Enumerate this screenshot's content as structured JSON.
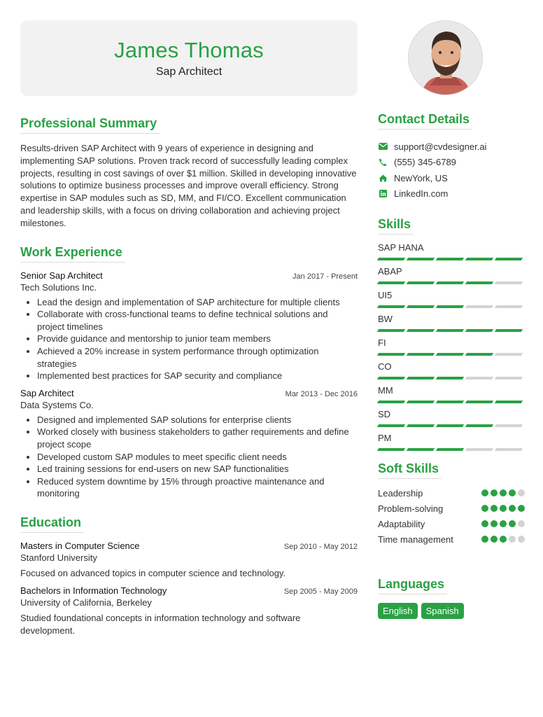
{
  "header": {
    "name": "James Thomas",
    "title": "Sap Architect"
  },
  "photo": {
    "alt": "profile-photo"
  },
  "sections": {
    "summary": "Professional Summary",
    "experience": "Work Experience",
    "education": "Education",
    "contact": "Contact Details",
    "skills": "Skills",
    "soft_skills": "Soft Skills",
    "languages": "Languages"
  },
  "summary": "Results-driven SAP Architect with 9 years of experience in designing and implementing SAP solutions. Proven track record of successfully leading complex projects, resulting in cost savings of over $1 million. Skilled in developing innovative solutions to optimize business processes and improve overall efficiency. Strong expertise in SAP modules such as SD, MM, and FI/CO. Excellent communication and leadership skills, with a focus on driving collaboration and achieving project milestones.",
  "experience": [
    {
      "title": "Senior Sap Architect",
      "date": "Jan 2017 - Present",
      "company": "Tech Solutions Inc.",
      "bullets": [
        "Lead the design and implementation of SAP architecture for multiple clients",
        "Collaborate with cross-functional teams to define technical solutions and project timelines",
        "Provide guidance and mentorship to junior team members",
        "Achieved a 20% increase in system performance through optimization strategies",
        "Implemented best practices for SAP security and compliance"
      ]
    },
    {
      "title": "Sap Architect",
      "date": "Mar 2013 - Dec 2016",
      "company": "Data Systems Co.",
      "bullets": [
        "Designed and implemented SAP solutions for enterprise clients",
        "Worked closely with business stakeholders to gather requirements and define project scope",
        "Developed custom SAP modules to meet specific client needs",
        "Led training sessions for end-users on new SAP functionalities",
        "Reduced system downtime by 15% through proactive maintenance and monitoring"
      ]
    }
  ],
  "education": [
    {
      "degree": "Masters in Computer Science",
      "date": "Sep 2010 - May 2012",
      "school": "Stanford University",
      "desc": "Focused on advanced topics in computer science and technology."
    },
    {
      "degree": "Bachelors in Information Technology",
      "date": "Sep 2005 - May 2009",
      "school": "University of California, Berkeley",
      "desc": "Studied foundational concepts in information technology and software development."
    }
  ],
  "contact": [
    {
      "icon": "email-icon",
      "text": "support@cvdesigner.ai"
    },
    {
      "icon": "phone-icon",
      "text": "(555) 345-6789"
    },
    {
      "icon": "home-icon",
      "text": "NewYork, US"
    },
    {
      "icon": "linkedin-icon",
      "text": "LinkedIn.com"
    }
  ],
  "skills": [
    {
      "name": "SAP HANA",
      "level": 5,
      "max": 5
    },
    {
      "name": "ABAP",
      "level": 4,
      "max": 5
    },
    {
      "name": "UI5",
      "level": 3,
      "max": 5
    },
    {
      "name": "BW",
      "level": 5,
      "max": 5
    },
    {
      "name": "FI",
      "level": 4,
      "max": 5
    },
    {
      "name": "CO",
      "level": 3,
      "max": 5
    },
    {
      "name": "MM",
      "level": 5,
      "max": 5
    },
    {
      "name": "SD",
      "level": 4,
      "max": 5
    },
    {
      "name": "PM",
      "level": 3,
      "max": 5
    }
  ],
  "soft_skills": [
    {
      "name": "Leadership",
      "level": 4,
      "max": 5
    },
    {
      "name": "Problem-solving",
      "level": 5,
      "max": 5
    },
    {
      "name": "Adaptability",
      "level": 4,
      "max": 5
    },
    {
      "name": "Time management",
      "level": 3,
      "max": 5
    }
  ],
  "languages": [
    "English",
    "Spanish"
  ],
  "colors": {
    "accent": "#2aa144",
    "inactive": "#d3d3d3",
    "header_bg": "#f2f2f2"
  }
}
